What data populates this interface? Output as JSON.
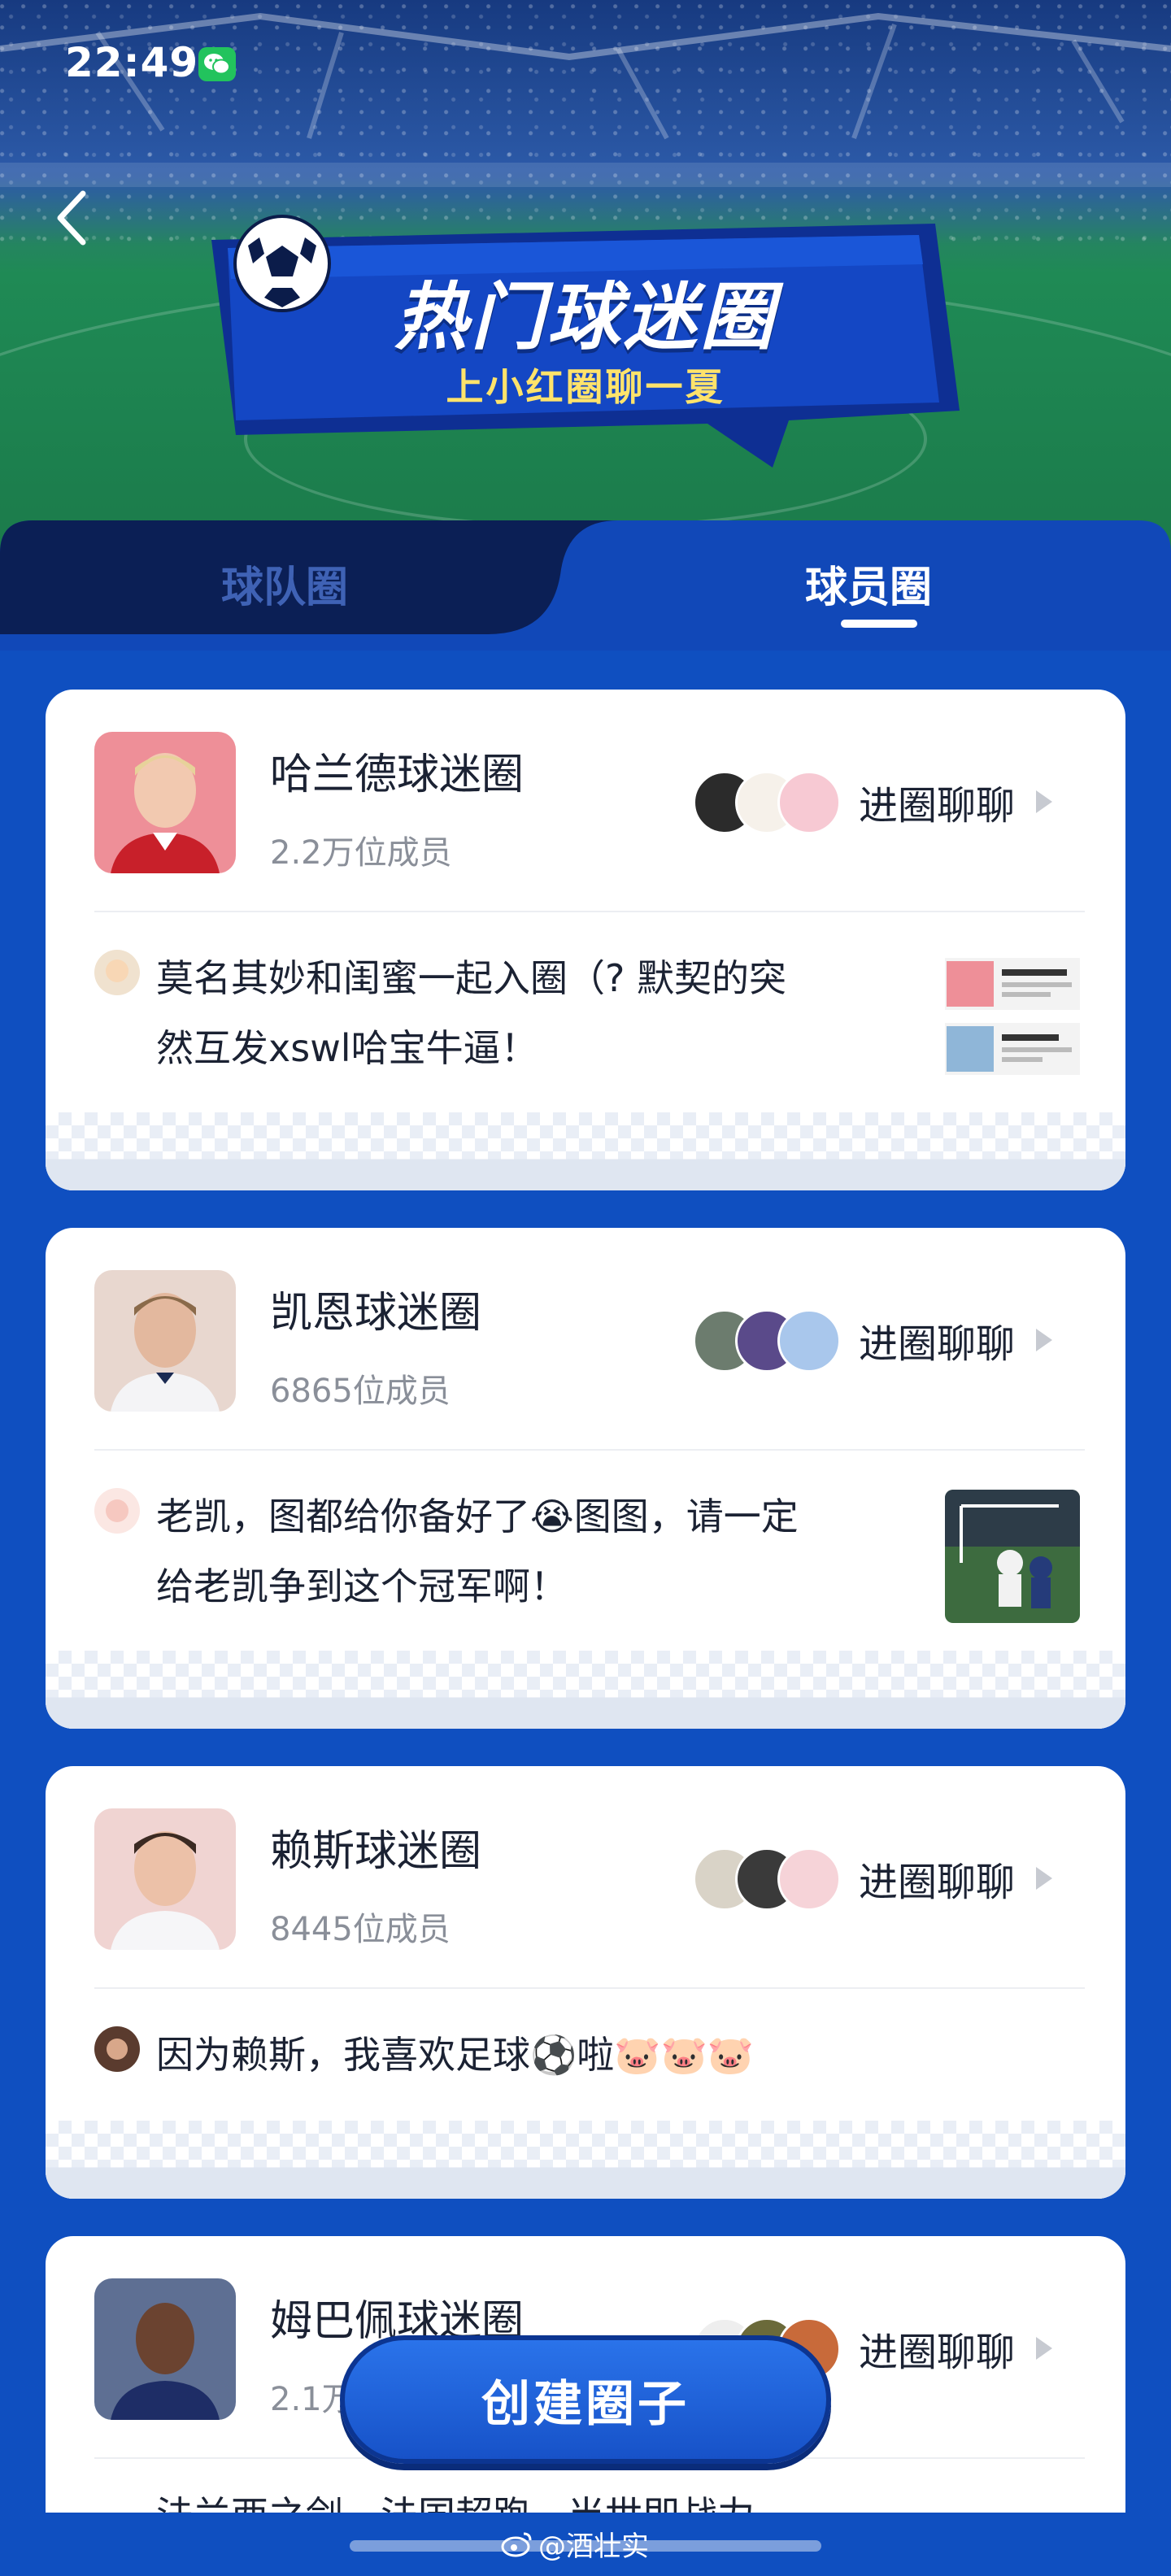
{
  "status_bar": {
    "time": "22:49"
  },
  "banner": {
    "title": "热门球迷圈",
    "subtitle": "上小红圈聊一夏"
  },
  "tabs": [
    {
      "label": "球队圈",
      "active": false
    },
    {
      "label": "球员圈",
      "active": true
    }
  ],
  "cards": [
    {
      "name": "哈兰德球迷圈",
      "members": "2.2万位成员",
      "join_label": "进圈聊聊",
      "post_lines": [
        "莫名其妙和闺蜜一起入圈（? 默契的突",
        "然互发xswl哈宝牛逼！"
      ]
    },
    {
      "name": "凯恩球迷圈",
      "members": "6865位成员",
      "join_label": "进圈聊聊",
      "post_lines": [
        "老凯，图都给你备好了😭图图，请一定",
        "给老凯争到这个冠军啊！"
      ]
    },
    {
      "name": "赖斯球迷圈",
      "members": "8445位成员",
      "join_label": "进圈聊聊",
      "post_lines": [
        "因为赖斯，我喜欢足球⚽啦🐷🐷🐷"
      ]
    },
    {
      "name": "姆巴佩球迷圈",
      "members": "2.1万",
      "join_label": "进圈聊聊",
      "post_lines": [
        "法兰西之剑，法国超跑，当世即战力"
      ]
    }
  ],
  "create_button": {
    "label": "创建圈子"
  },
  "watermark": {
    "text": "@酒壮实"
  },
  "colors": {
    "background": "#0f4fc0",
    "accent": "#1752c8",
    "card": "#ffffff"
  }
}
